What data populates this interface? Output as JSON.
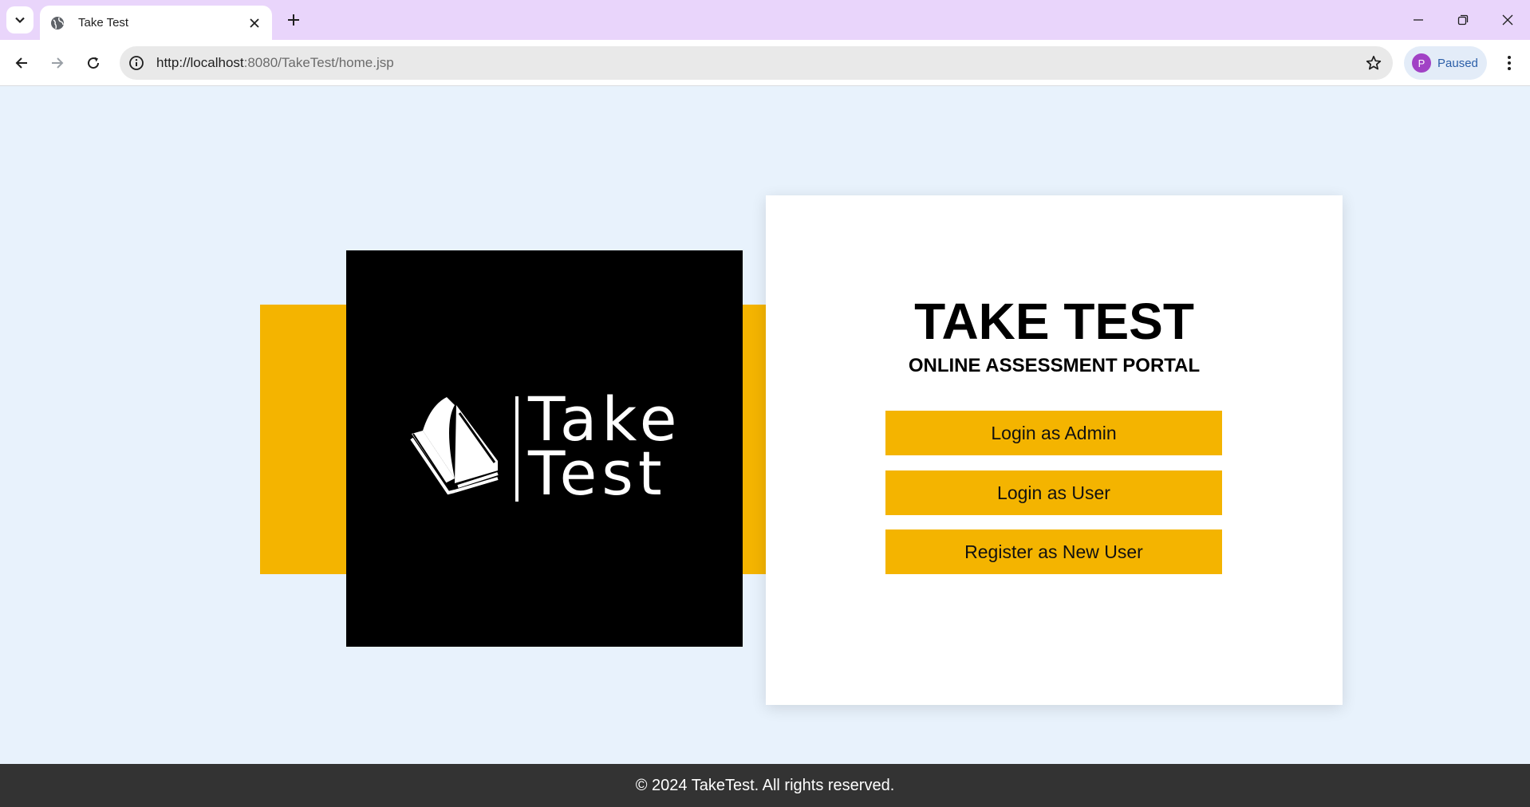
{
  "browser": {
    "tab_title": "Take Test",
    "url_host": "http://localhost",
    "url_rest": ":8080/TakeTest/home.jsp",
    "profile_initial": "P",
    "profile_status": "Paused",
    "icons": [
      "tab-list-icon",
      "globe-icon",
      "close-icon",
      "plus-icon",
      "minimize-icon",
      "restore-icon",
      "window-close-icon",
      "back-arrow-icon",
      "forward-arrow-icon",
      "reload-icon",
      "site-info-icon",
      "star-icon",
      "more-vert-icon"
    ]
  },
  "logo": {
    "line1": "Take",
    "line2": "Test"
  },
  "card": {
    "title": "TAKE TEST",
    "subtitle": "ONLINE ASSESSMENT PORTAL",
    "buttons": [
      {
        "label": "Login as Admin"
      },
      {
        "label": "Login as User"
      },
      {
        "label": "Register as New User"
      }
    ]
  },
  "footer": {
    "text": "© 2024 TakeTest. All rights reserved."
  },
  "colors": {
    "page_background": "#e8f2fc",
    "accent_yellow": "#f4b400",
    "logo_background": "#000000",
    "footer_background": "#333333",
    "tabbar": "#e9d5fb"
  }
}
